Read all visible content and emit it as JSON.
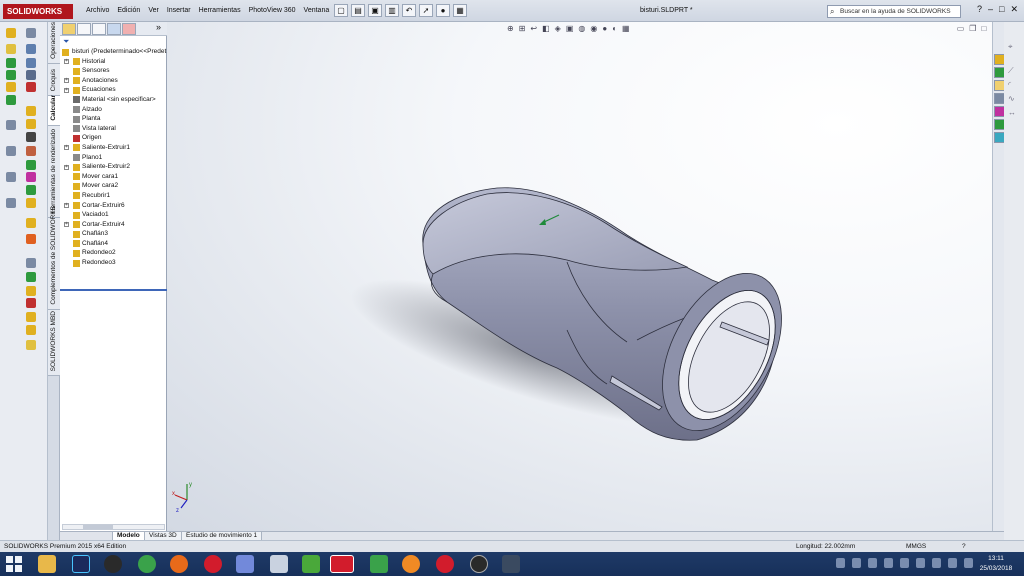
{
  "app": {
    "logo": "SOLIDWORKS",
    "menu": [
      "Archivo",
      "Edición",
      "Ver",
      "Insertar",
      "Herramientas",
      "PhotoView 360",
      "Ventana"
    ],
    "menu_pin": "✦",
    "document_title": "bisturi.SLDPRT *",
    "search_placeholder": "Buscar en la ayuda de SOLIDWORKS",
    "window_controls": [
      "?",
      "–",
      "□",
      "✕"
    ]
  },
  "command_tabs": [
    "Operaciones",
    "Croquis",
    "Calcular",
    "Herramientas de renderizado",
    "Complementos de SOLIDWORKS",
    "SOLIDWORKS MBD"
  ],
  "active_command_tab": "Calcular",
  "feature_tree": {
    "root": "bisturi  (Predeterminado<<Predet",
    "items": [
      {
        "label": "Historial",
        "expand": "+",
        "icon": "history-icon",
        "color": "#e0b020"
      },
      {
        "label": "Sensores",
        "expand": "",
        "icon": "sensor-icon",
        "color": "#e0b020"
      },
      {
        "label": "Anotaciones",
        "expand": "+",
        "icon": "annotation-icon",
        "color": "#e0b020"
      },
      {
        "label": "Ecuaciones",
        "expand": "+",
        "icon": "equation-icon",
        "color": "#e0b020"
      },
      {
        "label": "Material <sin especificar>",
        "expand": "",
        "icon": "material-icon",
        "color": "#6a6a6a"
      },
      {
        "label": "Alzado",
        "expand": "",
        "icon": "plane-icon",
        "color": "#8a8a8a"
      },
      {
        "label": "Planta",
        "expand": "",
        "icon": "plane-icon",
        "color": "#8a8a8a"
      },
      {
        "label": "Vista lateral",
        "expand": "",
        "icon": "plane-icon",
        "color": "#8a8a8a"
      },
      {
        "label": "Origen",
        "expand": "",
        "icon": "origin-icon",
        "color": "#c03030"
      },
      {
        "label": "Saliente-Extruir1",
        "expand": "+",
        "icon": "extrude-icon",
        "color": "#e0b020"
      },
      {
        "label": "Plano1",
        "expand": "",
        "icon": "plane-icon",
        "color": "#8a8a8a"
      },
      {
        "label": "Saliente-Extruir2",
        "expand": "+",
        "icon": "extrude-icon",
        "color": "#e0b020"
      },
      {
        "label": "Mover cara1",
        "expand": "",
        "icon": "move-face-icon",
        "color": "#e0b020"
      },
      {
        "label": "Mover cara2",
        "expand": "",
        "icon": "move-face-icon",
        "color": "#e0b020"
      },
      {
        "label": "Recubrir1",
        "expand": "",
        "icon": "loft-icon",
        "color": "#e0b020"
      },
      {
        "label": "Cortar-Extruir6",
        "expand": "+",
        "icon": "cut-extrude-icon",
        "color": "#e0b020"
      },
      {
        "label": "Vaciado1",
        "expand": "",
        "icon": "shell-icon",
        "color": "#e0b020"
      },
      {
        "label": "Cortar-Extruir4",
        "expand": "+",
        "icon": "cut-extrude-icon",
        "color": "#e0b020"
      },
      {
        "label": "Chaflán3",
        "expand": "",
        "icon": "chamfer-icon",
        "color": "#e0b020"
      },
      {
        "label": "Chaflán4",
        "expand": "",
        "icon": "chamfer-icon",
        "color": "#e0b020"
      },
      {
        "label": "Redondeo2",
        "expand": "",
        "icon": "fillet-icon",
        "color": "#e0b020"
      },
      {
        "label": "Redondeo3",
        "expand": "",
        "icon": "fillet-icon",
        "color": "#e0b020"
      }
    ]
  },
  "panel_collapse": "»",
  "bottom_tabs": [
    "Modelo",
    "Vistas 3D",
    "Estudio de movimiento 1"
  ],
  "active_bottom_tab": "Modelo",
  "status": {
    "product": "SOLIDWORKS Premium 2015 x64 Edition",
    "measure": "Longitud: 22.002mm",
    "units": "MMGS",
    "help": "?"
  },
  "clock": {
    "time": "13:11",
    "date": "25/03/2018"
  },
  "colors": {
    "accent": "#b0161d",
    "model": "#8f93ad",
    "selection": "#3e66b8"
  }
}
